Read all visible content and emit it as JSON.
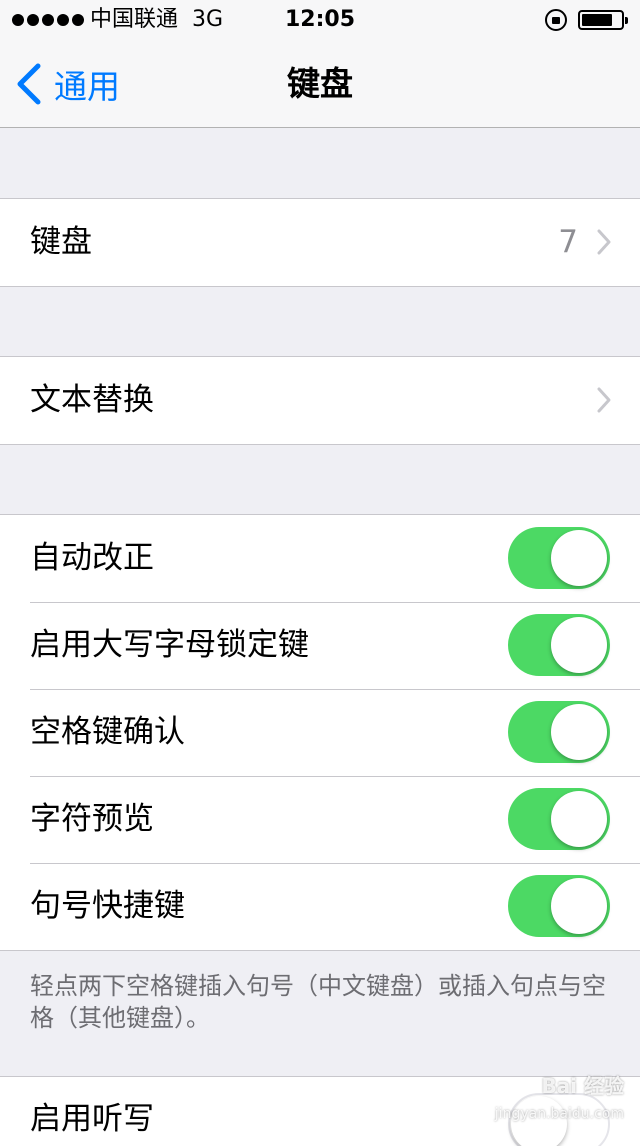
{
  "status_bar": {
    "carrier": "中国联通",
    "network": "3G",
    "time": "12:05",
    "battery_level": 0.8,
    "signal_bars": 5
  },
  "nav": {
    "back_label": "通用",
    "title": "键盘"
  },
  "rows": {
    "keyboards": {
      "label": "键盘",
      "detail": "7"
    },
    "text_replacement": {
      "label": "文本替换"
    },
    "auto_correct": {
      "label": "自动改正",
      "on": true
    },
    "caps_lock": {
      "label": "启用大写字母锁定键",
      "on": true
    },
    "space_confirm": {
      "label": "空格键确认",
      "on": true
    },
    "char_preview": {
      "label": "字符预览",
      "on": true
    },
    "period_shortcut": {
      "label": "句号快捷键",
      "on": true
    },
    "dictation": {
      "label": "启用听写",
      "on": false
    }
  },
  "footer_note": "轻点两下空格键插入句号（中文键盘）或插入句点与空格（其他键盘）。",
  "watermark": {
    "text": "Bai 经验",
    "sub": "jingyan.baidu.com"
  },
  "colors": {
    "accent": "#007aff",
    "toggle_on": "#4cd964",
    "background": "#efeff4"
  },
  "icons": [
    "lock-rotation-icon",
    "battery-icon",
    "back-chevron-icon",
    "chevron-right-icon"
  ]
}
